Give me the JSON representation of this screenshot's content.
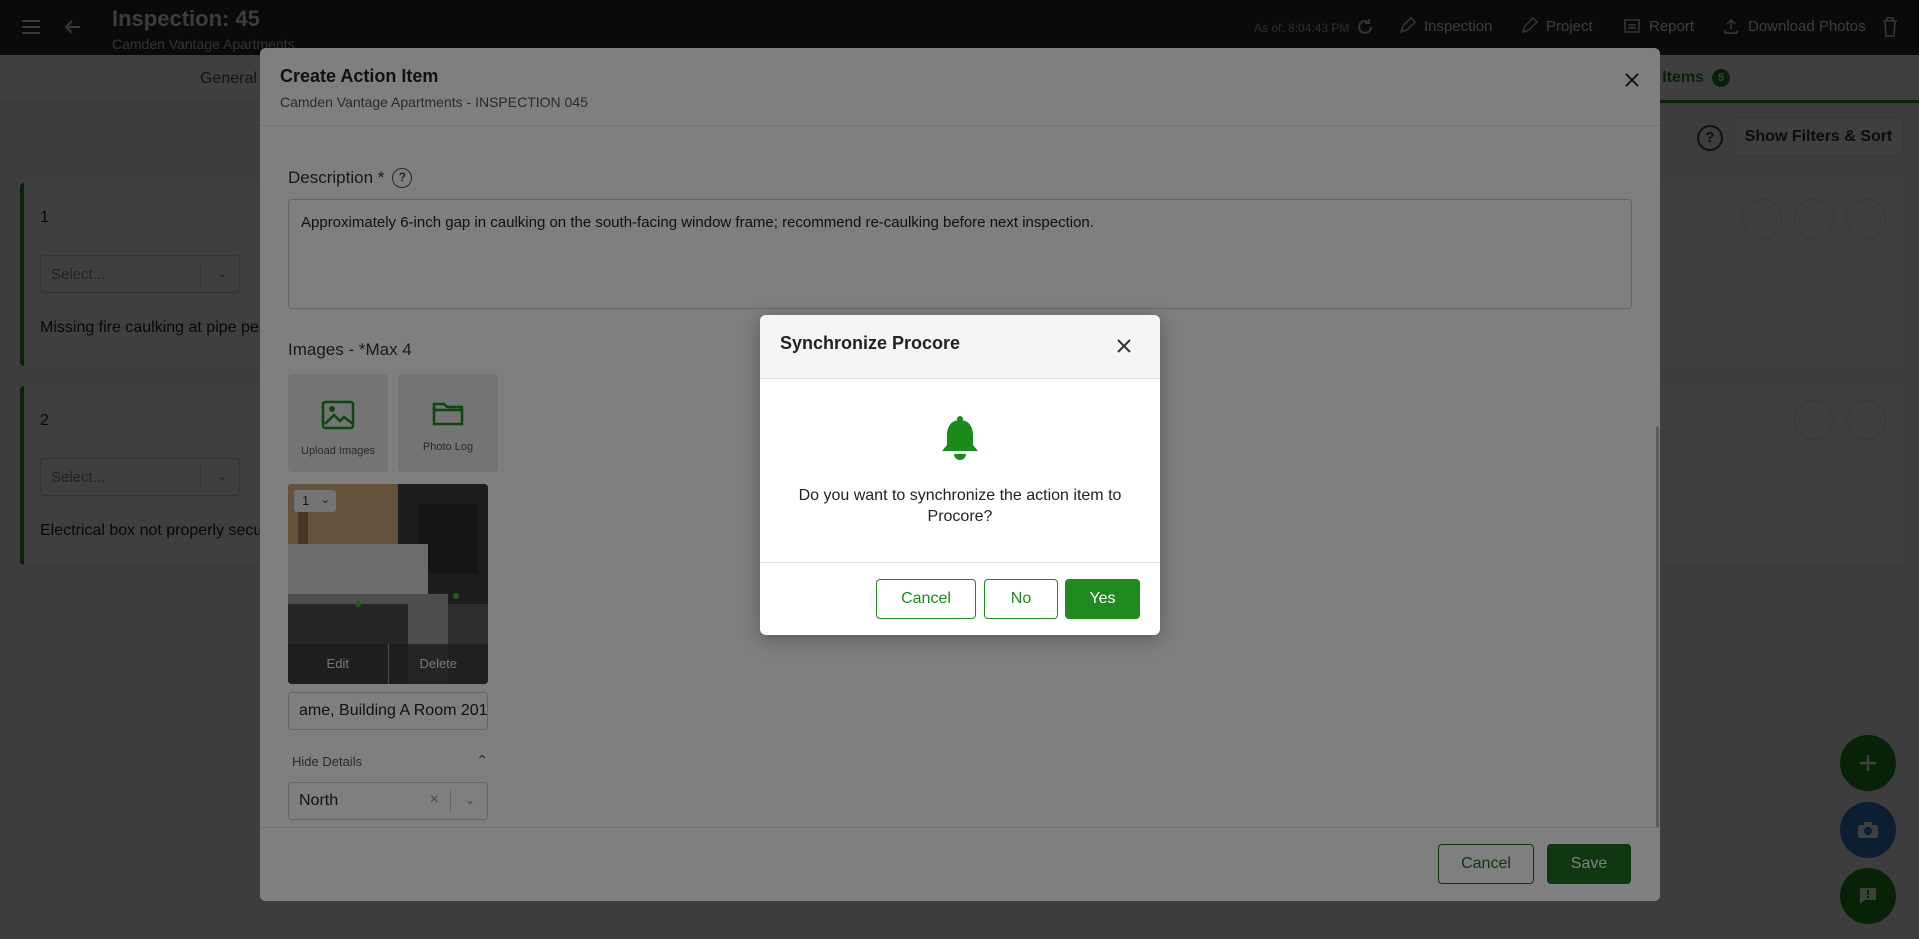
{
  "page": {
    "title": "Inspection: 45",
    "subtitle": "Camden Vantage Apartments",
    "as_of": "As of: 8:04:43 PM",
    "actions": {
      "inspection": "Inspection",
      "project": "Project",
      "report": "Report",
      "download_photos": "Download Photos"
    },
    "tabs": {
      "general": "General",
      "action_items": "n Items",
      "action_items_count": "5"
    },
    "help": "?",
    "filters_label": "Show Filters & Sort",
    "cards": [
      {
        "number": "1",
        "select_placeholder": "Select...",
        "description": "Missing fire caulking at pipe per"
      },
      {
        "number": "2",
        "select_placeholder": "Select...",
        "description": "Electrical box not properly secur"
      }
    ]
  },
  "modal": {
    "title": "Create Action Item",
    "subtitle": "Camden Vantage Apartments - INSPECTION 045",
    "description_label": "Description *",
    "description_help": "?",
    "description_value": "Approximately 6-inch gap in caulking on the south-facing window frame; recommend re-caulking before next inspection.",
    "images_label": "Images - *Max 4",
    "upload_label": "Upload Images",
    "photo_log_label": "Photo Log",
    "image_number": "1",
    "edit_label": "Edit",
    "delete_label": "Delete",
    "caption_value": "ame, Building A Room 201",
    "hide_details": "Hide Details",
    "direction_value": "North",
    "cancel_label": "Cancel",
    "save_label": "Save"
  },
  "sync_dialog": {
    "title": "Synchronize Procore",
    "message": "Do you want to synchronize the action item to Procore?",
    "cancel_label": "Cancel",
    "no_label": "No",
    "yes_label": "Yes"
  },
  "colors": {
    "accent_green": "#1f8a1f",
    "dark_green": "#1f6e1f",
    "header_dark": "#2b2b2b",
    "camera_blue": "#2d78c8"
  },
  "icons": [
    "menu-icon",
    "back-arrow-icon",
    "refresh-icon",
    "pencil-icon",
    "report-icon",
    "upload-icon",
    "trash-icon",
    "close-icon",
    "image-upload-icon",
    "folder-icon",
    "chevron-down-icon",
    "chevron-up-icon",
    "bell-icon",
    "plus-icon",
    "camera-icon",
    "chat-icon"
  ]
}
